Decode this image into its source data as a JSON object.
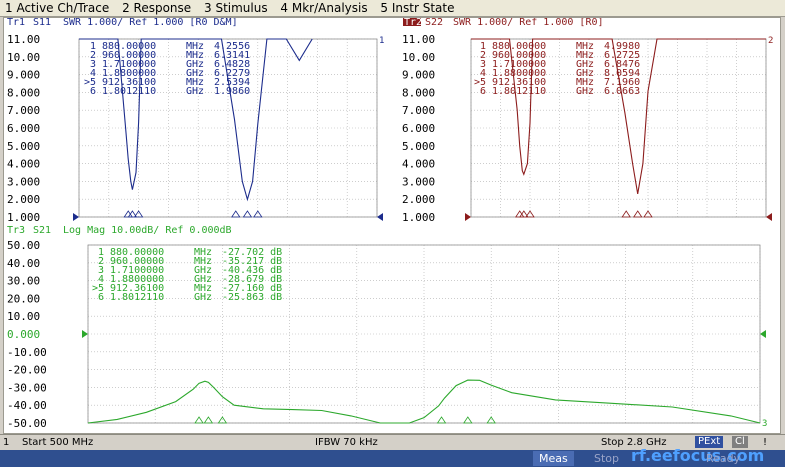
{
  "menu": [
    "1 Active Ch/Trace",
    "2 Response",
    "3 Stimulus",
    "4 Mkr/Analysis",
    "5 Instr State"
  ],
  "tr1": {
    "header_name": "Tr1",
    "header_param": "S11",
    "header_rest": "SWR 1.000/ Ref 1.000 [R0 D&M]",
    "color": "#1c2c8c",
    "yticks": [
      "11.00",
      "10.00",
      "9.000",
      "8.000",
      "7.000",
      "6.000",
      "5.000",
      "4.000",
      "3.000",
      "2.000",
      "1.000"
    ],
    "markers": [
      {
        "n": "1",
        "freq": "880.00000",
        "unit": "MHz",
        "val": "4.2556"
      },
      {
        "n": "2",
        "freq": "960.00000",
        "unit": "MHz",
        "val": "6.3141"
      },
      {
        "n": "3",
        "freq": "1.7100000",
        "unit": "GHz",
        "val": "6.4828"
      },
      {
        "n": "4",
        "freq": "1.8800000",
        "unit": "GHz",
        "val": "6.2279"
      },
      {
        "n": ">5",
        "freq": "912.36100",
        "unit": "MHz",
        "val": "2.5394"
      },
      {
        "n": "6",
        "freq": "1.8012110",
        "unit": "GHz",
        "val": "1.9860"
      }
    ],
    "end_label": "1"
  },
  "tr2": {
    "header_name": "Tr2",
    "header_param": "S22",
    "header_rest": "SWR 1.000/ Ref 1.000 [R0]",
    "color": "#8c1c1c",
    "yticks": [
      "11.00",
      "10.00",
      "9.000",
      "8.000",
      "7.000",
      "6.000",
      "5.000",
      "4.000",
      "3.000",
      "2.000",
      "1.000"
    ],
    "markers": [
      {
        "n": "1",
        "freq": "880.00000",
        "unit": "MHz",
        "val": "4.9980"
      },
      {
        "n": "2",
        "freq": "960.00000",
        "unit": "MHz",
        "val": "6.2725"
      },
      {
        "n": "3",
        "freq": "1.7100000",
        "unit": "GHz",
        "val": "6.8476"
      },
      {
        "n": "4",
        "freq": "1.8800000",
        "unit": "GHz",
        "val": "8.0594"
      },
      {
        "n": ">5",
        "freq": "912.36100",
        "unit": "MHz",
        "val": "7.1960"
      },
      {
        "n": "6",
        "freq": "1.8012110",
        "unit": "GHz",
        "val": "6.0663"
      }
    ],
    "end_label": "2"
  },
  "tr3": {
    "header_name": "Tr3",
    "header_param": "S21",
    "header_rest": "Log Mag 10.00dB/ Ref 0.000dB",
    "color": "#2ca82c",
    "yticks": [
      "50.00",
      "40.00",
      "30.00",
      "20.00",
      "10.00",
      "0.000",
      "-10.00",
      "-20.00",
      "-30.00",
      "-40.00",
      "-50.00"
    ],
    "markers": [
      {
        "n": "1",
        "freq": "880.00000",
        "unit": "MHz",
        "val": "-27.702 dB"
      },
      {
        "n": "2",
        "freq": "960.00000",
        "unit": "MHz",
        "val": "-35.217 dB"
      },
      {
        "n": "3",
        "freq": "1.7100000",
        "unit": "GHz",
        "val": "-40.436 dB"
      },
      {
        "n": "4",
        "freq": "1.8800000",
        "unit": "GHz",
        "val": "-28.679 dB"
      },
      {
        "n": ">5",
        "freq": "912.36100",
        "unit": "MHz",
        "val": "-27.160 dB"
      },
      {
        "n": "6",
        "freq": "1.8012110",
        "unit": "GHz",
        "val": "-25.863 dB"
      }
    ],
    "end_label": "3"
  },
  "status": {
    "channel": "1",
    "start": "Start 500 MHz",
    "ifbw": "IFBW 70 kHz",
    "stop": "Stop 2.8 GHz",
    "pext": "PExt",
    "cal": "Cl",
    "warn": "!"
  },
  "bottom": {
    "meas": "Meas",
    "stop_btn": "Stop",
    "ready": "Ready",
    "watermark": "rf.eefocus.com"
  },
  "chart_data": [
    {
      "type": "line",
      "title": "Tr1 S11 SWR 1.000/ Ref 1.000 [R0 D&M]",
      "x_range_mhz": [
        500,
        2800
      ],
      "ylim": [
        1,
        11
      ],
      "series": [
        {
          "name": "S11",
          "x": [
            500,
            800,
            860,
            880,
            900,
            912,
            940,
            960,
            980,
            1050,
            1200,
            1400,
            1600,
            1700,
            1760,
            1800,
            1840,
            1880,
            1950,
            2000,
            2100,
            2200,
            2300
          ],
          "y": [
            11,
            11,
            6,
            4.26,
            3,
            2.54,
            3.5,
            6.31,
            11,
            11,
            11,
            11,
            11,
            6.48,
            3,
            1.99,
            3,
            6.23,
            11,
            11,
            11,
            9.8,
            11
          ]
        }
      ]
    },
    {
      "type": "line",
      "title": "Tr2 S22 SWR 1.000/ Ref 1.000 [R0]",
      "x_range_mhz": [
        500,
        2800
      ],
      "ylim": [
        1,
        11
      ],
      "series": [
        {
          "name": "S22",
          "x": [
            500,
            800,
            860,
            880,
            900,
            912,
            940,
            960,
            980,
            1050,
            1600,
            1700,
            1760,
            1800,
            1840,
            1880,
            1950,
            2800
          ],
          "y": [
            11,
            11,
            7,
            5.0,
            3.6,
            3.4,
            4,
            6.27,
            11,
            11,
            11,
            6.85,
            4,
            2.3,
            4,
            8.06,
            11,
            11
          ]
        }
      ]
    },
    {
      "type": "line",
      "title": "Tr3 S21 Log Mag 10.00dB/ Ref 0.000dB",
      "x_range_mhz": [
        500,
        2800
      ],
      "ylim": [
        -50,
        50
      ],
      "series": [
        {
          "name": "S21",
          "x": [
            500,
            600,
            700,
            800,
            860,
            880,
            900,
            912,
            930,
            960,
            1000,
            1100,
            1200,
            1300,
            1400,
            1500,
            1600,
            1650,
            1700,
            1720,
            1760,
            1800,
            1840,
            1880,
            1950,
            2100,
            2300,
            2500,
            2700,
            2800
          ],
          "y": [
            -50,
            -48,
            -44,
            -38,
            -31,
            -27.7,
            -26.5,
            -27.2,
            -30,
            -35.2,
            -40,
            -42,
            -42.5,
            -43,
            -46,
            -50,
            -50,
            -47,
            -40.4,
            -36,
            -29,
            -25.9,
            -26,
            -28.7,
            -33,
            -37,
            -39,
            -41,
            -46,
            -50
          ]
        }
      ]
    }
  ]
}
